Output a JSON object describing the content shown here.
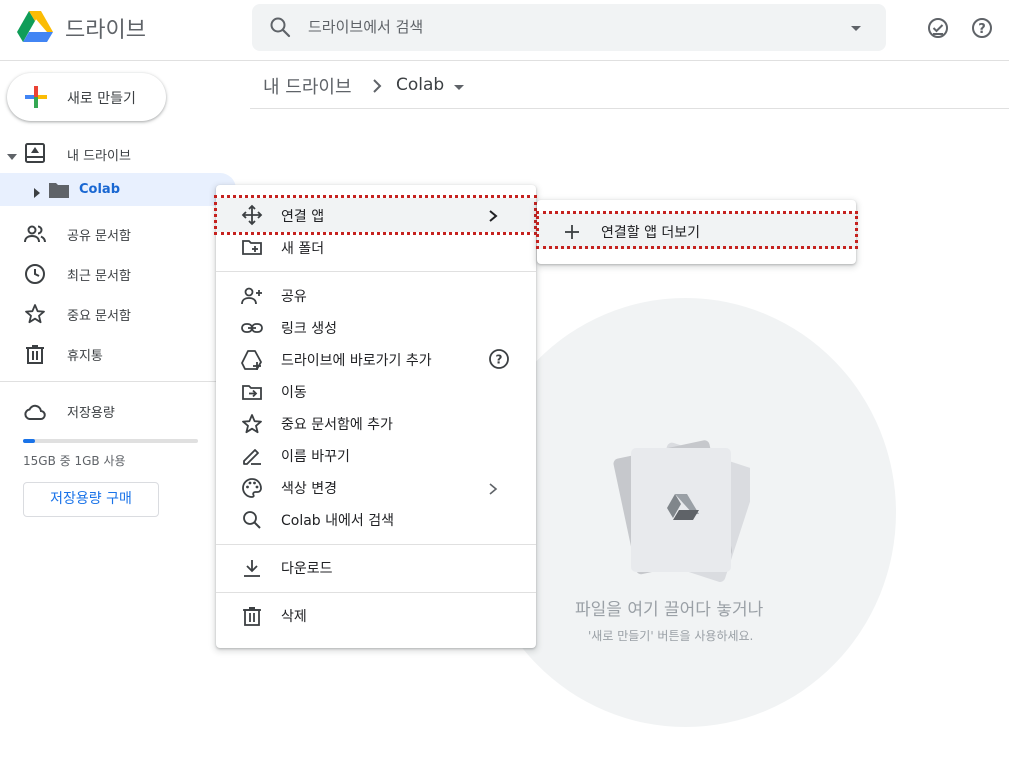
{
  "header": {
    "app_title": "드라이브",
    "search_placeholder": "드라이브에서 검색",
    "icons": [
      "drive-logo-icon",
      "search-icon",
      "search-options-icon",
      "ready-offline-icon",
      "help-icon"
    ]
  },
  "sidebar": {
    "new_button": "새로 만들기",
    "items": [
      {
        "label": "내 드라이브",
        "icon": "my-drive-icon"
      },
      {
        "label": "Colab",
        "icon": "folder-icon"
      },
      {
        "label": "공유 문서함",
        "icon": "shared-icon"
      },
      {
        "label": "최근 문서함",
        "icon": "recent-icon"
      },
      {
        "label": "중요 문서함",
        "icon": "star-icon"
      },
      {
        "label": "휴지통",
        "icon": "trash-icon"
      },
      {
        "label": "저장용량",
        "icon": "cloud-icon"
      }
    ],
    "storage_text": "15GB 중 1GB 사용",
    "storage_used_fraction": 0.067,
    "buy_storage": "저장용량 구매"
  },
  "breadcrumb": {
    "root": "내 드라이브",
    "current": "Colab"
  },
  "empty_state": {
    "title": "파일을 여기 끌어다 놓거나",
    "subtitle": "'새로 만들기' 버튼을 사용하세요."
  },
  "context_menu": {
    "items": [
      {
        "label": "연결 앱",
        "icon": "connected-apps-icon"
      },
      {
        "label": "새 폴더",
        "icon": "new-folder-icon"
      },
      {
        "label": "공유",
        "icon": "share-icon"
      },
      {
        "label": "링크 생성",
        "icon": "link-icon"
      },
      {
        "label": "드라이브에 바로가기 추가",
        "icon": "add-shortcut-icon"
      },
      {
        "label": "이동",
        "icon": "move-icon"
      },
      {
        "label": "중요 문서함에 추가",
        "icon": "star-icon"
      },
      {
        "label": "이름 바꾸기",
        "icon": "rename-icon"
      },
      {
        "label": "색상 변경",
        "icon": "palette-icon"
      },
      {
        "label": "Colab 내에서 검색",
        "icon": "search-icon"
      },
      {
        "label": "다운로드",
        "icon": "download-icon"
      },
      {
        "label": "삭제",
        "icon": "trash-icon"
      }
    ]
  },
  "submenu": {
    "item": "연결할 앱 더보기"
  },
  "colors": {
    "accent_blue": "#1a73e8",
    "selection_bg": "#e8f0fe",
    "highlight_border": "#c5221f"
  }
}
